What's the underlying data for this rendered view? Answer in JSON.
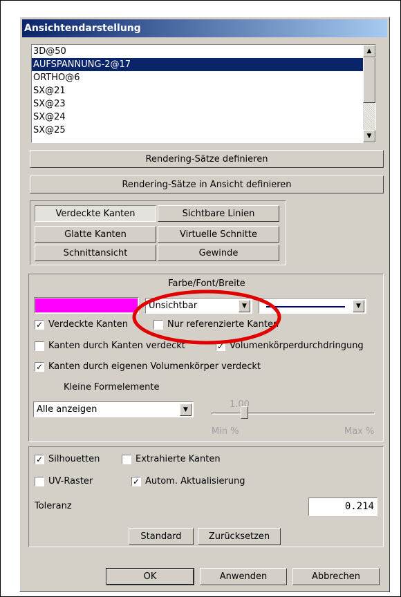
{
  "dialog": {
    "title": "Ansichtendarstellung"
  },
  "views": {
    "items": [
      "3D@50",
      "AUFSPANNUNG-2@17",
      "ORTHO@6",
      "SX@21",
      "SX@23",
      "SX@24",
      "SX@25"
    ],
    "selected_index": 1
  },
  "rendering": {
    "define_sets": "Rendering-Sätze definieren",
    "define_sets_in_view": "Rendering-Sätze in Ansicht definieren"
  },
  "edge_tabs": {
    "hidden_edges": "Verdeckte Kanten",
    "visible_lines": "Sichtbare Linien",
    "smooth_edges": "Glatte Kanten",
    "virtual_sections": "Virtuelle Schnitte",
    "section_view": "Schnittansicht",
    "threads": "Gewinde"
  },
  "style": {
    "heading": "Farbe/Font/Breite",
    "color_hex": "#ff00ff",
    "font_value": "Unsichtbar",
    "line_color_hex": "#000080",
    "annotation_color_hex": "#e00000"
  },
  "options": {
    "hidden_edges": {
      "label": "Verdeckte Kanten",
      "checked": true
    },
    "referenced_only": {
      "label": "Nur referenzierte Kanten",
      "checked": false
    },
    "edges_hidden_by_edges": {
      "label": "Kanten durch Kanten verdeckt",
      "checked": false
    },
    "solid_intersection": {
      "label": "Volumenkörperdurchdringung",
      "checked": true
    },
    "hidden_by_own_solid": {
      "label": "Kanten durch eigenen Volumenkörper verdeckt",
      "checked": true
    }
  },
  "features": {
    "label": "Kleine Formelemente",
    "slider_value": "1.00",
    "select_value": "Alle anzeigen",
    "min_label": "Min %",
    "max_label": "Max %",
    "slider_level": 0.2
  },
  "silhouettes": {
    "silhouettes": {
      "label": "Silhouetten",
      "checked": true
    },
    "extracted_edges": {
      "label": "Extrahierte Kanten",
      "checked": false
    },
    "uv_grid": {
      "label": "UV-Raster",
      "checked": false
    },
    "auto_update": {
      "label": "Autom. Aktualisierung",
      "checked": true
    },
    "tolerance_label": "Toleranz",
    "tolerance_value": "0.214",
    "standard": "Standard",
    "reset": "Zurücksetzen"
  },
  "buttons": {
    "ok": "OK",
    "apply": "Anwenden",
    "cancel": "Abbrechen"
  }
}
